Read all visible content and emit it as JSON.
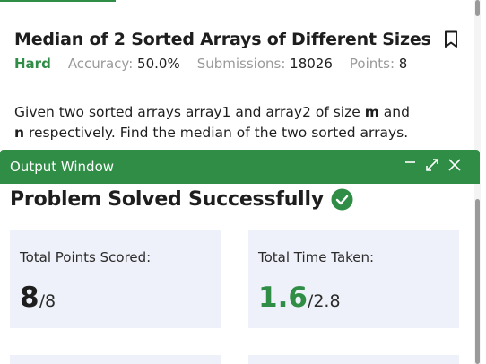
{
  "problem": {
    "title": "Median of 2 Sorted Arrays of Different Sizes",
    "difficulty": "Hard",
    "accuracy_label": "Accuracy:",
    "accuracy_value": "50.0%",
    "submissions_label": "Submissions:",
    "submissions_value": "18026",
    "points_label": "Points:",
    "points_value": "8",
    "description": {
      "part1": "Given two sorted arrays array1 and array2 of size ",
      "m": "m",
      "part2": " and",
      "n": "n",
      "part3": " respectively. Find the median of the two sorted arrays."
    }
  },
  "output_window": {
    "title": "Output Window",
    "minimize_icon": "minimize-icon",
    "expand_icon": "expand-icon",
    "close_icon": "close-icon",
    "status_text": "Problem Solved Successfully",
    "cards": [
      {
        "label": "Total Points Scored:",
        "value": "8",
        "total": "/8"
      },
      {
        "label": "Total Time Taken:",
        "value": "1.6",
        "total": "/2.8"
      }
    ]
  },
  "colors": {
    "accent": "#2f8d46",
    "card_bg": "#eef1f9",
    "muted": "#9a9a9a"
  }
}
